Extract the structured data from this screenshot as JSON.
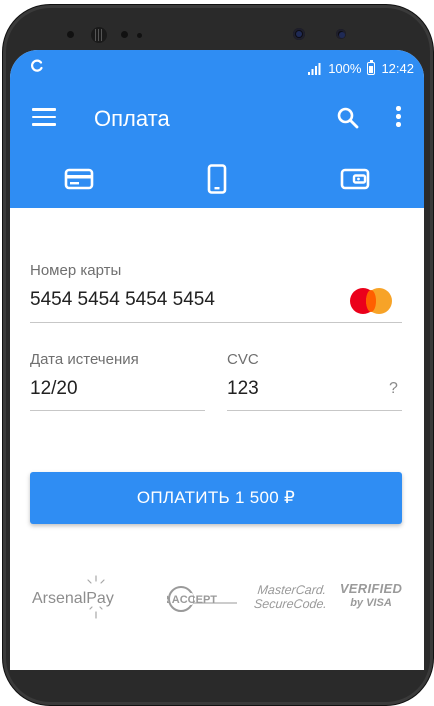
{
  "status_bar": {
    "battery_percent": "100%",
    "time": "12:42"
  },
  "toolbar": {
    "title": "Оплата",
    "menu_icon": "hamburger-menu-icon",
    "search_icon": "search-icon",
    "more_icon": "more-vertical-icon"
  },
  "tabs": [
    {
      "icon": "credit-card-icon",
      "selected": true
    },
    {
      "icon": "mobile-phone-icon",
      "selected": false
    },
    {
      "icon": "wallet-icon",
      "selected": false
    }
  ],
  "form": {
    "card_number": {
      "label": "Номер карты",
      "value": "5454 5454 5454 5454",
      "brand_icon": "mastercard-logo"
    },
    "expiry": {
      "label": "Дата истечения",
      "value": "12/20"
    },
    "cvc": {
      "label": "CVC",
      "value": "123",
      "help": "?"
    }
  },
  "pay_button": {
    "label": "ОПЛАТИТЬ 1 500 ₽"
  },
  "footer_logos": {
    "arsenal": "ArsenalPay",
    "mir": "MIR ACCEPT",
    "mastercard_line1": "MasterCard.",
    "mastercard_line2": "SecureCode.",
    "verified_line1": "VERIFIED",
    "verified_line2": "by VISA"
  },
  "colors": {
    "primary": "#2f8df3",
    "text": "#212121",
    "label": "#6f6f6f",
    "divider": "#c7c7c7"
  }
}
